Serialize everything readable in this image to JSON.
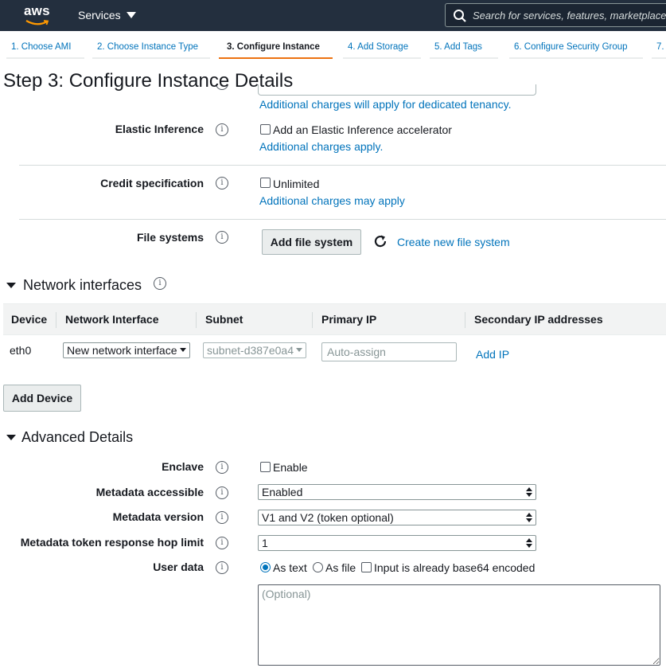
{
  "topnav": {
    "logo_text": "aws",
    "services_label": "Services",
    "search_placeholder": "Search for services, features, marketplace products, and docs"
  },
  "wizard": {
    "steps": [
      {
        "label": "1. Choose AMI"
      },
      {
        "label": "2. Choose Instance Type"
      },
      {
        "label": "3. Configure Instance"
      },
      {
        "label": "4. Add Storage"
      },
      {
        "label": "5. Add Tags"
      },
      {
        "label": "6. Configure Security Group"
      },
      {
        "label": "7."
      }
    ],
    "active_step": 3
  },
  "page_title": "Step 3: Configure Instance Details",
  "tenancy": {
    "charges_link": "Additional charges will apply for dedicated tenancy."
  },
  "elastic_inference": {
    "label": "Elastic Inference",
    "checkbox_label": "Add an Elastic Inference accelerator",
    "checked": false,
    "charges_link": "Additional charges apply."
  },
  "credit_specification": {
    "label": "Credit specification",
    "checkbox_label": "Unlimited",
    "checked": false,
    "charges_link": "Additional charges may apply"
  },
  "file_systems": {
    "label": "File systems",
    "add_button": "Add file system",
    "create_link": "Create new file system"
  },
  "network_interfaces": {
    "title": "Network interfaces",
    "columns": [
      "Device",
      "Network Interface",
      "Subnet",
      "Primary IP",
      "Secondary IP addresses"
    ],
    "rows": [
      {
        "device": "eth0",
        "network_interface": "New network interface",
        "subnet": "subnet-d387e0a4",
        "primary_ip_placeholder": "Auto-assign",
        "add_ip_link": "Add IP"
      }
    ],
    "add_device_button": "Add Device"
  },
  "advanced_details": {
    "title": "Advanced Details",
    "enclave": {
      "label": "Enclave",
      "checkbox_label": "Enable",
      "checked": false
    },
    "metadata_accessible": {
      "label": "Metadata accessible",
      "value": "Enabled"
    },
    "metadata_version": {
      "label": "Metadata version",
      "value": "V1 and V2 (token optional)"
    },
    "hop_limit": {
      "label": "Metadata token response hop limit",
      "value": "1"
    },
    "user_data": {
      "label": "User data",
      "options": [
        "As text",
        "As file"
      ],
      "selected": "As text",
      "base64_label": "Input is already base64 encoded",
      "base64_checked": false,
      "placeholder": "(Optional)"
    }
  },
  "colors": {
    "nav_bg": "#232f3e",
    "link": "#0073bb",
    "active_tab_accent": "#ec7211",
    "logo_smile": "#ff9900"
  },
  "icons": [
    "search-icon",
    "caret-down-icon",
    "info-icon",
    "refresh-icon",
    "collapse-caret-icon",
    "select-arrow-icon"
  ]
}
